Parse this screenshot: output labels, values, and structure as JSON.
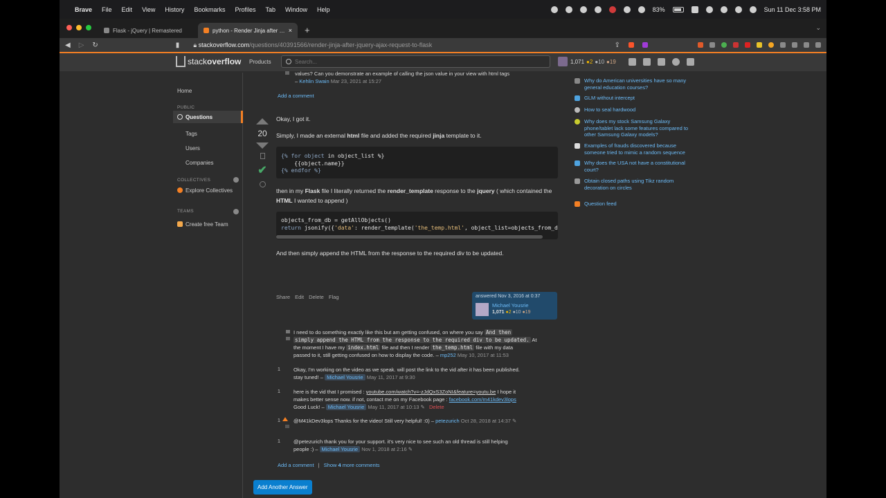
{
  "menubar": {
    "app_name": "Brave",
    "menus": [
      "File",
      "Edit",
      "View",
      "History",
      "Bookmarks",
      "Profiles",
      "Tab",
      "Window",
      "Help"
    ],
    "battery": "83%",
    "clock": "Sun 11 Dec  3:58 PM"
  },
  "browser": {
    "tabs": [
      {
        "title": "Flask - jQuery | Remastered"
      },
      {
        "title": "python - Render Jinja after jQuery AJAX request to flask"
      }
    ],
    "url_host": "stackoverflow.com",
    "url_path": "/questions/40391566/render-jinja-after-jquery-ajax-request-to-flask"
  },
  "so": {
    "logo_light": "stack",
    "logo_bold": "overflow",
    "products": "Products",
    "search_placeholder": "Search...",
    "user_rep": "1,071",
    "gold": "●2",
    "silver": "●10",
    "bronze": "●19"
  },
  "leftnav": {
    "home": "Home",
    "public_header": "PUBLIC",
    "questions": "Questions",
    "tags": "Tags",
    "users": "Users",
    "companies": "Companies",
    "collectives_header": "COLLECTIVES",
    "explore_collectives": "Explore Collectives",
    "teams_header": "TEAMS",
    "create_team": "Create free Team"
  },
  "main": {
    "prev_comment_text": "values? Can you demonstrate an example of calling the json value in your view with html tags",
    "prev_comment_dash": "–",
    "prev_comment_user": "Kehlin Swain",
    "prev_comment_date": "Mar 23, 2021 at 15:27",
    "add_comment_top": "Add a comment",
    "answer": {
      "score": "20",
      "p1": "Okay, I got it.",
      "p2_a": "Simply, I made an external ",
      "p2_b": "html",
      "p2_c": " file and added the required ",
      "p2_d": "jinja",
      "p2_e": " template to it.",
      "code1_line1_kw": "{% for object ",
      "code1_line1_b": "in",
      "code1_line1_c": " object_list %}",
      "code1_line2": "    {{object.name}}",
      "code1_line3": "{% endfor %}",
      "p3_a": "then in my ",
      "p3_b": "Flask",
      "p3_c": " file I literally returned the ",
      "p3_d": "render_template",
      "p3_e": " response to the ",
      "p3_f": "jquery",
      "p3_g": " ( which contained the ",
      "p3_h": "HTML",
      "p3_i": " I wanted to append )",
      "code2_line1": "objects_from_db = getAllObjects()",
      "code2_line2_a": "return",
      "code2_line2_b": " jsonify({",
      "code2_line2_c": "'data'",
      "code2_line2_d": ": render_template(",
      "code2_line2_e": "'the_temp.html'",
      "code2_line2_f": ", object_list=objects_from_db",
      "p4": "And then simply append the HTML from the response to the required div to be updated.",
      "menu": [
        "Share",
        "Edit",
        "Delete",
        "Flag"
      ],
      "answered": "answered Nov 3, 2016 at 0:37",
      "author": "Michael Yousrie",
      "author_rep": "1,071",
      "author_gold": "●2",
      "author_silver": "●10",
      "author_bronze": "●19"
    },
    "comments": [
      {
        "score": "",
        "t1": "I need to do something exactly like this but am getting confused, on where you say",
        "c1": "And then",
        "c2": "simply append the HTML from the response to the required div to be updated.",
        "t2": "At",
        "t3": "the moment I have my",
        "c3": "index.html",
        "t4": "file and then I render",
        "c4": "the_temp.html",
        "t5": "file with my data",
        "t6": "passed to it, still getting confused on how to display the code.",
        "dash": "–",
        "user": "mp252",
        "date": "May 10, 2017 at 11:53"
      },
      {
        "score": "1",
        "text_line1": "Okay, I'm working on the video as we speak. will post the link to the vid after it has been published.",
        "text_line2": "stay tuned!",
        "dash": "–",
        "user": "Michael Yousrie",
        "date": "May 11, 2017 at 9:30"
      },
      {
        "score": "1",
        "t1": "here is the vid that I promised :",
        "link1": "youtube.com/watch?v=-zJdQxS3ZoNI&feature=youtu.be",
        "t2": "I hope it",
        "t3": "makes better sense now. if not, contact me on my Facebook page :",
        "link2": "facebook.com/m41kdev3lops",
        "t4": "Good Luck!",
        "dash": "–",
        "user": "Michael Yousrie",
        "date": "May 11, 2017 at 10:13",
        "delete": "Delete"
      },
      {
        "score": "1",
        "text": "@M41kDev3lops Thanks for the video! Still very helpful! :0)",
        "dash": "–",
        "user": "petezurich",
        "date": "Oct 28, 2018 at 14:37"
      },
      {
        "score": "1",
        "text_line1": "@petezurich thank you for your support. it's very nice to see such an old thread is still helping",
        "text_line2": "people :)",
        "dash": "–",
        "user": "Michael Yousrie",
        "date": "Nov 1, 2018 at 2:16"
      }
    ],
    "add_comment": "Add a comment",
    "separator": "|",
    "show_more_a": "Show ",
    "show_more_b": "4",
    "show_more_c": " more comments",
    "add_answer": "Add Another Answer"
  },
  "sidebar": {
    "hot": [
      {
        "line1": "Why do American universities have so many",
        "line2": "general education courses?"
      },
      {
        "line1": "GLM without intercept",
        "line2": ""
      },
      {
        "line1": "How to seal hardwood",
        "line2": ""
      },
      {
        "line1": "Why does my stock Samsung Galaxy",
        "line2": "phone/tablet lack some features compared to",
        "line3": "other Samsung Galaxy models?"
      },
      {
        "line1": "Examples of frauds discovered because",
        "line2": "someone tried to mimic a random sequence"
      },
      {
        "line1": "Why does the USA not have a constitutional",
        "line2": "court?"
      },
      {
        "line1": "Obtain closed paths using Tikz random",
        "line2": "decoration on circles"
      }
    ],
    "question_feed": "Question feed"
  }
}
